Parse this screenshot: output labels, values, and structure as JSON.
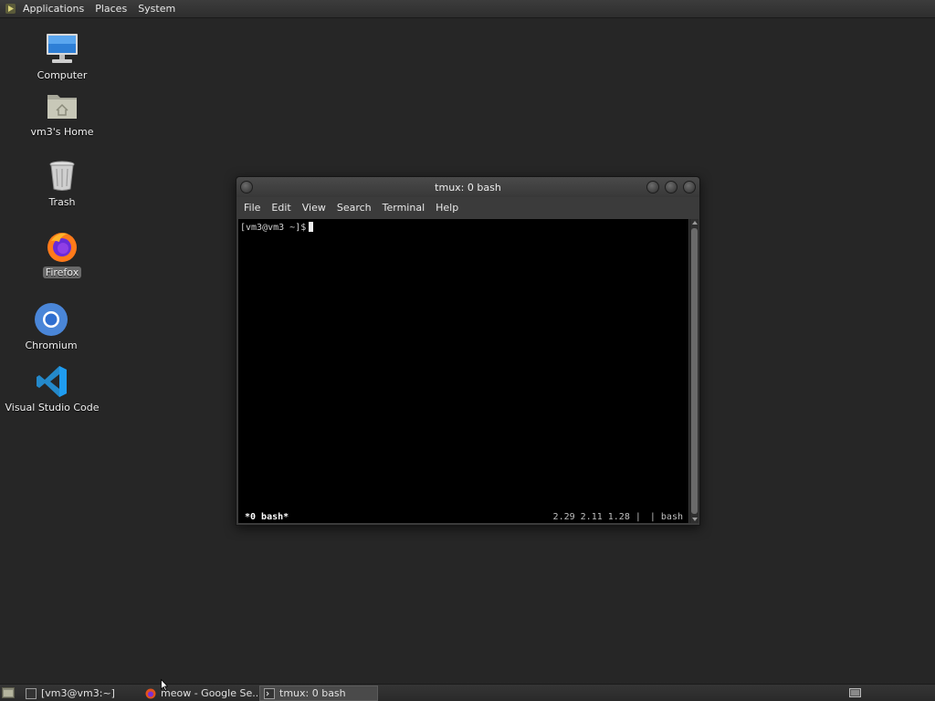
{
  "top_panel": {
    "menus": [
      "Applications",
      "Places",
      "System"
    ]
  },
  "desktop": {
    "icons": [
      {
        "label": "Computer",
        "icon": "computer-icon"
      },
      {
        "label": "vm3's Home",
        "icon": "home-folder-icon"
      },
      {
        "label": "Trash",
        "icon": "trash-icon"
      },
      {
        "label": "Firefox",
        "icon": "firefox-icon",
        "selected": true
      },
      {
        "label": "Chromium",
        "icon": "chromium-icon"
      },
      {
        "label": "Visual Studio Code",
        "icon": "vscode-icon"
      }
    ]
  },
  "terminal": {
    "title": "tmux: 0 bash",
    "menus": [
      "File",
      "Edit",
      "View",
      "Search",
      "Terminal",
      "Help"
    ],
    "prompt": "[vm3@vm3 ~]$",
    "status": {
      "window": "*0 bash*",
      "load": "2.29 2.11 1.28",
      "sep": "|",
      "sep2": "|",
      "session": "bash"
    }
  },
  "taskbar": {
    "tasks": [
      {
        "label": "[vm3@vm3:~]",
        "icon": "terminal-icon",
        "active": false
      },
      {
        "label": "meow - Google Se...",
        "icon": "firefox-icon",
        "active": false
      },
      {
        "label": "tmux: 0 bash",
        "icon": "terminal-icon",
        "active": true
      }
    ]
  },
  "colors": {
    "desktop_bg": "#262626",
    "panel_bg": "#2e2e2e",
    "terminal_bg": "#000000",
    "selected_label_bg": "#6a6a6a"
  }
}
